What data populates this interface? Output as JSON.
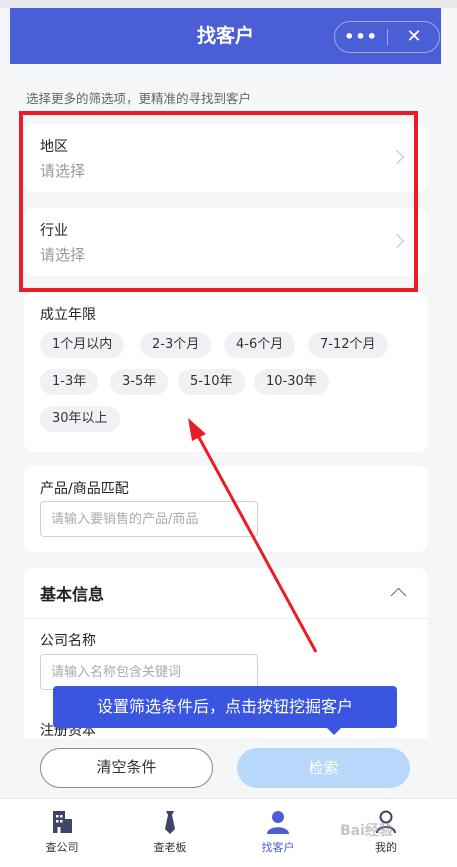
{
  "header": {
    "title": "找客户",
    "more_icon": "•••",
    "close_icon": "✕"
  },
  "hint": "选择更多的筛选项，更精准的寻找到客户",
  "region": {
    "label": "地区",
    "value": "请选择"
  },
  "industry": {
    "label": "行业",
    "value": "请选择"
  },
  "established": {
    "label": "成立年限",
    "options": [
      "1个月以内",
      "2-3个月",
      "4-6个月",
      "7-12个月",
      "1-3年",
      "3-5年",
      "5-10年",
      "10-30年",
      "30年以上"
    ]
  },
  "product": {
    "label": "产品/商品匹配",
    "placeholder": "请输入要销售的产品/商品"
  },
  "basic": {
    "title": "基本信息",
    "company_label": "公司名称",
    "company_placeholder": "请输入名称包含关键词",
    "legal_label_partial": "注册资本"
  },
  "tooltip": "设置筛选条件后，点击按钮挖掘客户",
  "buttons": {
    "clear": "清空条件",
    "search": "检索"
  },
  "tabs": [
    {
      "label": "查公司",
      "icon": "building-icon"
    },
    {
      "label": "查老板",
      "icon": "tie-icon"
    },
    {
      "label": "找客户",
      "icon": "person-icon",
      "active": true
    },
    {
      "label": "我的",
      "icon": "user-icon"
    }
  ],
  "watermark": "Bai经验",
  "colors": {
    "brand": "#4a5fd6",
    "annotation": "#ec1c24",
    "tooltip": "#3a55e0",
    "search_button": "#b8d8fa"
  }
}
